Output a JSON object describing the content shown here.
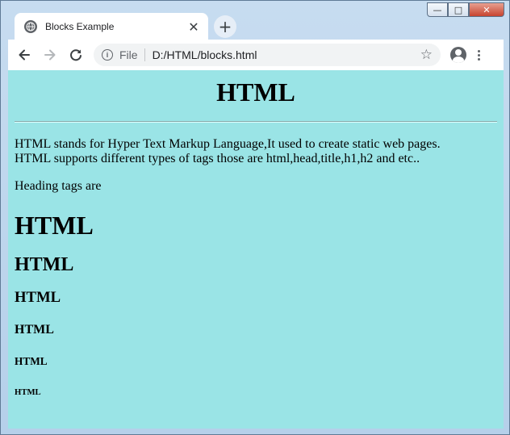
{
  "window": {
    "minimize_glyph": "—",
    "maximize_glyph": "□",
    "close_glyph": "✕"
  },
  "tab": {
    "title": "Blocks Example",
    "icon": "globe-icon",
    "close_glyph": "✕"
  },
  "new_tab_glyph": "+",
  "toolbar": {
    "back_icon": "back-arrow-icon",
    "forward_icon": "forward-arrow-icon",
    "reload_icon": "reload-icon",
    "scheme_label": "File",
    "url": "D:/HTML/blocks.html",
    "bookmark_icon": "star-icon",
    "profile_icon": "account-icon",
    "menu_icon": "kebab-menu-icon"
  },
  "page": {
    "background": "#9ae4e6",
    "title": "HTML",
    "intro_line1": "HTML stands for Hyper Text Markup Language,It used to create static web pages.",
    "intro_line2": "HTML supports different types of tags those are html,head,title,h1,h2 and etc..",
    "heading_intro": "Heading tags are",
    "headings": [
      "HTML",
      "HTML",
      "HTML",
      "HTML",
      "HTML",
      "HTML"
    ]
  }
}
